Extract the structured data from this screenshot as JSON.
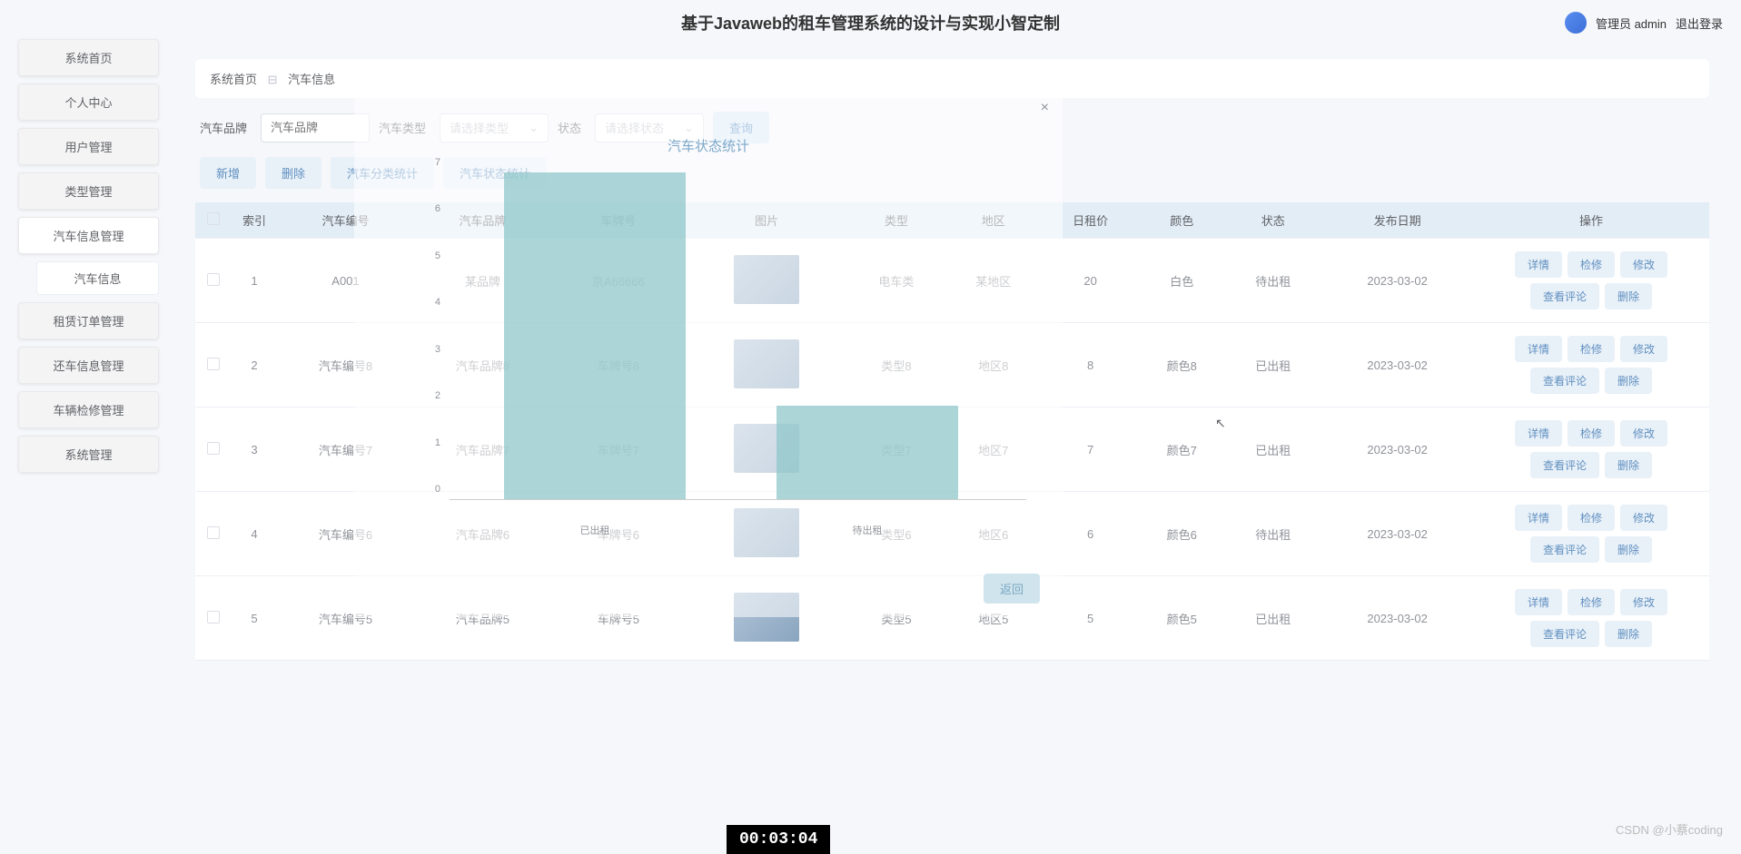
{
  "header": {
    "title": "基于Javaweb的租车管理系统的设计与实现小智定制",
    "user_label": "管理员 admin",
    "logout": "退出登录"
  },
  "sidebar": {
    "items": [
      {
        "label": "系统首页"
      },
      {
        "label": "个人中心"
      },
      {
        "label": "用户管理"
      },
      {
        "label": "类型管理"
      },
      {
        "label": "汽车信息管理",
        "children": [
          {
            "label": "汽车信息"
          }
        ]
      },
      {
        "label": "租赁订单管理"
      },
      {
        "label": "还车信息管理"
      },
      {
        "label": "车辆检修管理"
      },
      {
        "label": "系统管理"
      }
    ]
  },
  "breadcrumb": {
    "home": "系统首页",
    "current": "汽车信息"
  },
  "filters": {
    "brand_label": "汽车品牌",
    "brand_placeholder": "汽车品牌",
    "type_label": "汽车类型",
    "type_placeholder": "请选择类型",
    "status_label": "状态",
    "status_placeholder": "请选择状态",
    "search_btn": "查询"
  },
  "toolbar": {
    "add": "新增",
    "delete": "删除",
    "type_stats": "汽车分类统计",
    "status_stats": "汽车状态统计"
  },
  "table": {
    "headers": [
      "",
      "索引",
      "汽车编号",
      "汽车品牌",
      "车牌号",
      "图片",
      "类型",
      "地区",
      "日租价",
      "颜色",
      "状态",
      "发布日期",
      "操作"
    ],
    "rows": [
      {
        "idx": "1",
        "code": "A001",
        "brand": "某品牌",
        "plate": "京A66666",
        "type": "电车类",
        "region": "某地区",
        "price": "20",
        "color": "白色",
        "status": "待出租",
        "date": "2023-03-02"
      },
      {
        "idx": "2",
        "code": "汽车编号8",
        "brand": "汽车品牌8",
        "plate": "车牌号8",
        "type": "类型8",
        "region": "地区8",
        "price": "8",
        "color": "颜色8",
        "status": "已出租",
        "date": "2023-03-02"
      },
      {
        "idx": "3",
        "code": "汽车编号7",
        "brand": "汽车品牌7",
        "plate": "车牌号7",
        "type": "类型7",
        "region": "地区7",
        "price": "7",
        "color": "颜色7",
        "status": "已出租",
        "date": "2023-03-02"
      },
      {
        "idx": "4",
        "code": "汽车编号6",
        "brand": "汽车品牌6",
        "plate": "车牌号6",
        "type": "类型6",
        "region": "地区6",
        "price": "6",
        "color": "颜色6",
        "status": "待出租",
        "date": "2023-03-02"
      },
      {
        "idx": "5",
        "code": "汽车编号5",
        "brand": "汽车品牌5",
        "plate": "车牌号5",
        "type": "类型5",
        "region": "地区5",
        "price": "5",
        "color": "颜色5",
        "status": "已出租",
        "date": "2023-03-02"
      }
    ],
    "actions": {
      "detail": "详情",
      "repair": "检修",
      "edit": "修改",
      "comments": "查看评论",
      "delete": "删除"
    }
  },
  "modal": {
    "title": "汽车状态统计",
    "return_btn": "返回",
    "close": "×"
  },
  "chart_data": {
    "type": "bar",
    "categories": [
      "已出租",
      "待出租"
    ],
    "values": [
      7,
      2
    ],
    "title": "汽车状态统计",
    "xlabel": "",
    "ylabel": "",
    "ylim": [
      0,
      7
    ],
    "yticks": [
      0,
      1,
      2,
      3,
      4,
      5,
      6,
      7
    ]
  },
  "timer": "00:03:04",
  "watermark": "CSDN @小蔡coding"
}
